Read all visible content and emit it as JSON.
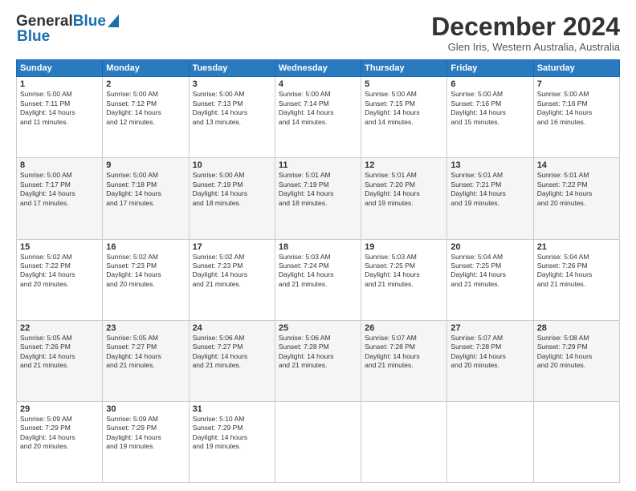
{
  "header": {
    "logo_line1_general": "General",
    "logo_line1_blue": "Blue",
    "logo_line2": "Blue",
    "month": "December 2024",
    "location": "Glen Iris, Western Australia, Australia"
  },
  "weekdays": [
    "Sunday",
    "Monday",
    "Tuesday",
    "Wednesday",
    "Thursday",
    "Friday",
    "Saturday"
  ],
  "weeks": [
    [
      {
        "day": 1,
        "info": "Sunrise: 5:00 AM\nSunset: 7:11 PM\nDaylight: 14 hours\nand 11 minutes."
      },
      {
        "day": 2,
        "info": "Sunrise: 5:00 AM\nSunset: 7:12 PM\nDaylight: 14 hours\nand 12 minutes."
      },
      {
        "day": 3,
        "info": "Sunrise: 5:00 AM\nSunset: 7:13 PM\nDaylight: 14 hours\nand 13 minutes."
      },
      {
        "day": 4,
        "info": "Sunrise: 5:00 AM\nSunset: 7:14 PM\nDaylight: 14 hours\nand 14 minutes."
      },
      {
        "day": 5,
        "info": "Sunrise: 5:00 AM\nSunset: 7:15 PM\nDaylight: 14 hours\nand 14 minutes."
      },
      {
        "day": 6,
        "info": "Sunrise: 5:00 AM\nSunset: 7:16 PM\nDaylight: 14 hours\nand 15 minutes."
      },
      {
        "day": 7,
        "info": "Sunrise: 5:00 AM\nSunset: 7:16 PM\nDaylight: 14 hours\nand 16 minutes."
      }
    ],
    [
      {
        "day": 8,
        "info": "Sunrise: 5:00 AM\nSunset: 7:17 PM\nDaylight: 14 hours\nand 17 minutes."
      },
      {
        "day": 9,
        "info": "Sunrise: 5:00 AM\nSunset: 7:18 PM\nDaylight: 14 hours\nand 17 minutes."
      },
      {
        "day": 10,
        "info": "Sunrise: 5:00 AM\nSunset: 7:19 PM\nDaylight: 14 hours\nand 18 minutes."
      },
      {
        "day": 11,
        "info": "Sunrise: 5:01 AM\nSunset: 7:19 PM\nDaylight: 14 hours\nand 18 minutes."
      },
      {
        "day": 12,
        "info": "Sunrise: 5:01 AM\nSunset: 7:20 PM\nDaylight: 14 hours\nand 19 minutes."
      },
      {
        "day": 13,
        "info": "Sunrise: 5:01 AM\nSunset: 7:21 PM\nDaylight: 14 hours\nand 19 minutes."
      },
      {
        "day": 14,
        "info": "Sunrise: 5:01 AM\nSunset: 7:22 PM\nDaylight: 14 hours\nand 20 minutes."
      }
    ],
    [
      {
        "day": 15,
        "info": "Sunrise: 5:02 AM\nSunset: 7:22 PM\nDaylight: 14 hours\nand 20 minutes."
      },
      {
        "day": 16,
        "info": "Sunrise: 5:02 AM\nSunset: 7:23 PM\nDaylight: 14 hours\nand 20 minutes."
      },
      {
        "day": 17,
        "info": "Sunrise: 5:02 AM\nSunset: 7:23 PM\nDaylight: 14 hours\nand 21 minutes."
      },
      {
        "day": 18,
        "info": "Sunrise: 5:03 AM\nSunset: 7:24 PM\nDaylight: 14 hours\nand 21 minutes."
      },
      {
        "day": 19,
        "info": "Sunrise: 5:03 AM\nSunset: 7:25 PM\nDaylight: 14 hours\nand 21 minutes."
      },
      {
        "day": 20,
        "info": "Sunrise: 5:04 AM\nSunset: 7:25 PM\nDaylight: 14 hours\nand 21 minutes."
      },
      {
        "day": 21,
        "info": "Sunrise: 5:04 AM\nSunset: 7:26 PM\nDaylight: 14 hours\nand 21 minutes."
      }
    ],
    [
      {
        "day": 22,
        "info": "Sunrise: 5:05 AM\nSunset: 7:26 PM\nDaylight: 14 hours\nand 21 minutes."
      },
      {
        "day": 23,
        "info": "Sunrise: 5:05 AM\nSunset: 7:27 PM\nDaylight: 14 hours\nand 21 minutes."
      },
      {
        "day": 24,
        "info": "Sunrise: 5:06 AM\nSunset: 7:27 PM\nDaylight: 14 hours\nand 21 minutes."
      },
      {
        "day": 25,
        "info": "Sunrise: 5:06 AM\nSunset: 7:28 PM\nDaylight: 14 hours\nand 21 minutes."
      },
      {
        "day": 26,
        "info": "Sunrise: 5:07 AM\nSunset: 7:28 PM\nDaylight: 14 hours\nand 21 minutes."
      },
      {
        "day": 27,
        "info": "Sunrise: 5:07 AM\nSunset: 7:28 PM\nDaylight: 14 hours\nand 20 minutes."
      },
      {
        "day": 28,
        "info": "Sunrise: 5:08 AM\nSunset: 7:29 PM\nDaylight: 14 hours\nand 20 minutes."
      }
    ],
    [
      {
        "day": 29,
        "info": "Sunrise: 5:09 AM\nSunset: 7:29 PM\nDaylight: 14 hours\nand 20 minutes."
      },
      {
        "day": 30,
        "info": "Sunrise: 5:09 AM\nSunset: 7:29 PM\nDaylight: 14 hours\nand 19 minutes."
      },
      {
        "day": 31,
        "info": "Sunrise: 5:10 AM\nSunset: 7:29 PM\nDaylight: 14 hours\nand 19 minutes."
      },
      null,
      null,
      null,
      null
    ]
  ]
}
